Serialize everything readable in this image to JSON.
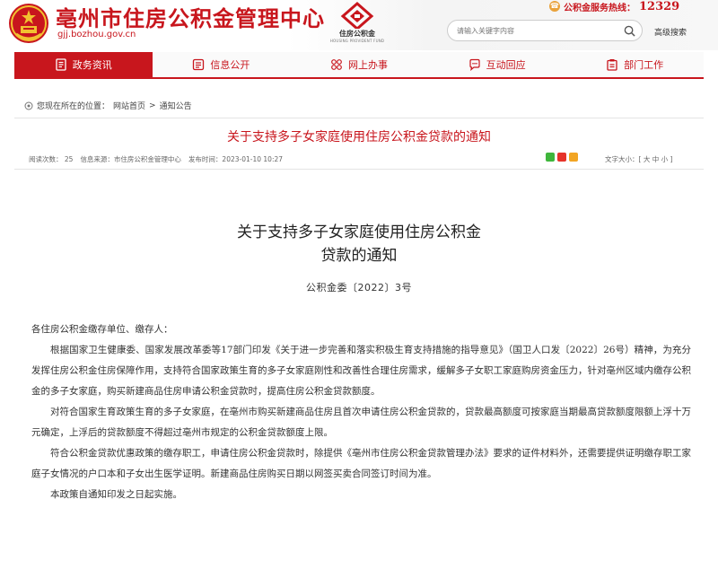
{
  "header": {
    "site_title": "亳州市住房公积金管理中心",
    "site_domain": "gjj.bozhou.gov.cn",
    "fund_logo_name": "住房公积金",
    "fund_logo_sub": "HOUSING PROVIDENT FUND",
    "hotline_label": "公积金服务热线：",
    "hotline_number": "12329",
    "search_placeholder": "请输入关键字内容",
    "advanced_search": "高级搜索",
    "brand_color": "#c8161d"
  },
  "nav": {
    "items": [
      {
        "label": "政务资讯",
        "icon": "document-icon",
        "active": true
      },
      {
        "label": "信息公开",
        "icon": "list-icon",
        "active": false
      },
      {
        "label": "网上办事",
        "icon": "network-icon",
        "active": false
      },
      {
        "label": "互动回应",
        "icon": "chat-icon",
        "active": false
      },
      {
        "label": "部门工作",
        "icon": "clipboard-icon",
        "active": false
      }
    ]
  },
  "breadcrumb": {
    "prefix": "您现在所在的位置：",
    "home": "网站首页",
    "separator": ">",
    "current": "通知公告"
  },
  "article": {
    "title": "关于支持多子女家庭使用住房公积金贷款的通知",
    "views": "阅读次数：  25",
    "source": "信息来源：市住房公积金管理中心",
    "published": "发布时间：2023-01-10 10:27",
    "font_size_label": "文字大小：[",
    "font_large": "大",
    "font_medium": "中",
    "font_small": "小",
    "font_size_close": "]"
  },
  "document": {
    "title_line1": "关于支持多子女家庭使用住房公积金",
    "title_line2": "贷款的通知",
    "number": "公积金委〔2022〕3号",
    "greeting": "各住房公积金缴存单位、缴存人：",
    "paragraphs": [
      "根据国家卫生健康委、国家发展改革委等17部门印发《关于进一步完善和落实积极生育支持措施的指导意见》（国卫人口发〔2022〕26号）精神，为充分发挥住房公积金住房保障作用，支持符合国家政策生育的多子女家庭刚性和改善性合理住房需求，缓解多子女职工家庭购房资金压力，针对亳州区域内缴存公积金的多子女家庭，购买新建商品住房申请公积金贷款时，提高住房公积金贷款额度。",
      "对符合国家生育政策生育的多子女家庭，在亳州市购买新建商品住房且首次申请住房公积金贷款的，贷款最高额度可按家庭当期最高贷款额度限额上浮十万元确定，上浮后的贷款额度不得超过亳州市规定的公积金贷款额度上限。",
      "符合公积金贷款优惠政策的缴存职工，申请住房公积金贷款时，除提供《亳州市住房公积金贷款管理办法》要求的证件材料外，还需要提供证明缴存职工家庭子女情况的户口本和子女出生医学证明。新建商品住房购买日期以网签买卖合同签订时间为准。",
      "本政策自通知印发之日起实施。"
    ]
  }
}
